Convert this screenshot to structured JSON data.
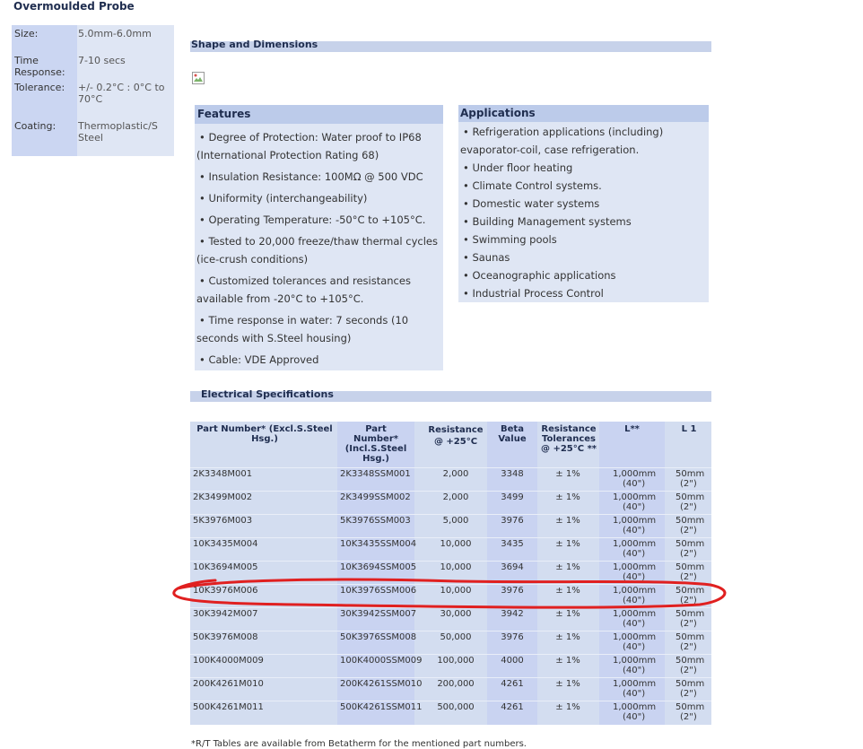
{
  "title": "Overmoulded Probe",
  "specs": [
    {
      "label": "Size:",
      "value": "5.0mm-6.0mm"
    },
    {
      "label": "Time Response:",
      "value": "7-10 secs"
    },
    {
      "label": "Tolerance:",
      "value": "+/- 0.2°C : 0°C to 70°C"
    },
    {
      "label": "Coating:",
      "value": "Thermoplastic/S Steel"
    }
  ],
  "sections": {
    "shape": "Shape and Dimensions",
    "electrical": "Electrical Specifications"
  },
  "features": {
    "heading": "Features",
    "lines": [
      "• Degree of Protection: Water proof to IP68",
      "(International Protection Rating 68)",
      "• Insulation Resistance: 100MΩ @ 500 VDC",
      "• Uniformity (interchangeability)",
      "• Operating Temperature: -50°C to +105°C.",
      "• Tested to 20,000 freeze/thaw thermal cycles",
      "(ice-crush conditions)",
      "• Customized tolerances and resistances",
      "available from -20°C to +105°C.",
      "• Time response in water: 7 seconds (10",
      "seconds with S.Steel housing)",
      "• Cable: VDE Approved"
    ]
  },
  "applications": {
    "heading": "Applications",
    "lines": [
      "• Refrigeration applications (including)",
      "evaporator-coil, case refrigeration.",
      "• Under floor heating",
      "• Climate Control systems.",
      "• Domestic water systems",
      "• Building Management systems",
      "• Swimming pools",
      "• Saunas",
      "• Oceanographic applications",
      "• Industrial Process Control"
    ]
  },
  "table": {
    "headers": {
      "part_excl": "Part Number* (Excl.S.Steel Hsg.)",
      "part_incl": "Part Number* (Incl.S.Steel Hsg.)",
      "resistance": "Resistance @ +25°C",
      "beta": "Beta Value",
      "tolerance": "Resistance Tolerances @ +25°C **",
      "length": "L**",
      "l1": "L 1"
    },
    "rows": [
      [
        "2K3348M001",
        "2K3348SSM001",
        "2,000",
        "3348",
        "± 1%",
        "1,000mm",
        "(40\")",
        "50mm",
        "(2\")"
      ],
      [
        "2K3499M002",
        "2K3499SSM002",
        "2,000",
        "3499",
        "± 1%",
        "1,000mm",
        "(40\")",
        "50mm",
        "(2\")"
      ],
      [
        "5K3976M003",
        "5K3976SSM003",
        "5,000",
        "3976",
        "± 1%",
        "1,000mm",
        "(40\")",
        "50mm",
        "(2\")"
      ],
      [
        "10K3435M004",
        "10K3435SSM004",
        "10,000",
        "3435",
        "± 1%",
        "1,000mm",
        "(40\")",
        "50mm",
        "(2\")"
      ],
      [
        "10K3694M005",
        "10K3694SSM005",
        "10,000",
        "3694",
        "± 1%",
        "1,000mm",
        "(40\")",
        "50mm",
        "(2\")"
      ],
      [
        "10K3976M006",
        "10K3976SSM006",
        "10,000",
        "3976",
        "± 1%",
        "1,000mm",
        "(40\")",
        "50mm",
        "(2\")"
      ],
      [
        "30K3942M007",
        "30K3942SSM007",
        "30,000",
        "3942",
        "± 1%",
        "1,000mm",
        "(40\")",
        "50mm",
        "(2\")"
      ],
      [
        "50K3976M008",
        "50K3976SSM008",
        "50,000",
        "3976",
        "± 1%",
        "1,000mm",
        "(40\")",
        "50mm",
        "(2\")"
      ],
      [
        "100K4000M009",
        "100K4000SSM009",
        "100,000",
        "4000",
        "± 1%",
        "1,000mm",
        "(40\")",
        "50mm",
        "(2\")"
      ],
      [
        "200K4261M010",
        "200K4261SSM010",
        "200,000",
        "4261",
        "± 1%",
        "1,000mm",
        "(40\")",
        "50mm",
        "(2\")"
      ],
      [
        "500K4261M011",
        "500K4261SSM011",
        "500,000",
        "4261",
        "± 1%",
        "1,000mm",
        "(40\")",
        "50mm",
        "(2\")"
      ]
    ]
  },
  "footnote": "*R/T Tables are available from Betatherm for the mentioned part numbers.",
  "colors": {
    "panel": "#dfe6f4",
    "panel_dark": "#cbd6f2",
    "highlight_col": "#c5cff0",
    "annotation": "#e02020"
  }
}
